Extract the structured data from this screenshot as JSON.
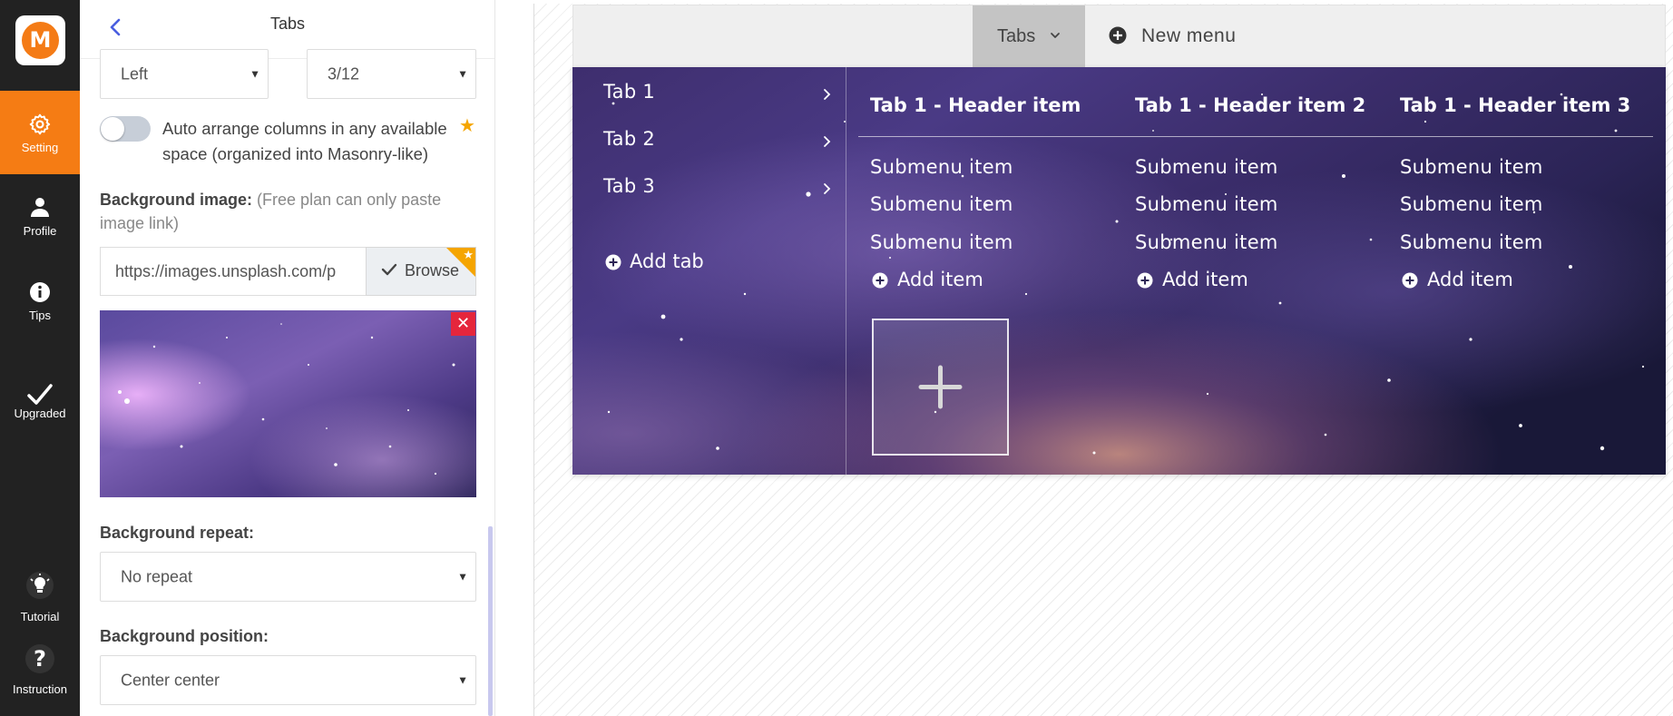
{
  "rail": {
    "logo_letter": "M",
    "items": [
      {
        "label": "Setting",
        "icon": "gear-icon",
        "active": true
      },
      {
        "label": "Profile",
        "icon": "user-icon",
        "active": false
      },
      {
        "label": "Tips",
        "icon": "info-icon",
        "active": false
      },
      {
        "label": "Upgraded",
        "icon": "checkmark-icon",
        "active": false
      },
      {
        "label": "Tutorial",
        "icon": "lightbulb-icon",
        "active": false
      },
      {
        "label": "Instruction",
        "icon": "question-icon",
        "active": false
      }
    ]
  },
  "panel": {
    "title": "Tabs",
    "alignment_select": {
      "value": "Left"
    },
    "width_select": {
      "value": "3/12"
    },
    "auto_arrange": {
      "label": "Auto arrange columns in any available space (organized into Masonry-like)",
      "enabled": false
    },
    "background_image": {
      "label": "Background image:",
      "note_line1": "(Free plan can only paste",
      "note_line2": "image link)",
      "url_value": "https://images.unsplash.com/p",
      "browse_label": "Browse"
    },
    "background_repeat": {
      "label": "Background repeat:",
      "value": "No repeat"
    },
    "background_position": {
      "label": "Background position:",
      "value": "Center center"
    }
  },
  "preview": {
    "menubar": {
      "active_tab_label": "Tabs",
      "new_menu_label": "New menu"
    },
    "mega": {
      "tabs": [
        "Tab 1",
        "Tab 2",
        "Tab 3"
      ],
      "add_tab_label": "Add tab",
      "columns": [
        {
          "header": "Tab 1 - Header item",
          "items": [
            "Submenu item",
            "Submenu item",
            "Submenu item"
          ],
          "add_label": "Add item"
        },
        {
          "header": "Tab 1 - Header item 2",
          "items": [
            "Submenu item",
            "Submenu item",
            "Submenu item"
          ],
          "add_label": "Add item"
        },
        {
          "header": "Tab 1 - Header item 3",
          "items": [
            "Submenu item",
            "Submenu item",
            "Submenu item"
          ],
          "add_label": "Add item"
        }
      ]
    }
  },
  "colors": {
    "accent": "#f57c14",
    "rail_bg": "#222222",
    "danger": "#e5263c",
    "premium_star": "#f5a500"
  }
}
